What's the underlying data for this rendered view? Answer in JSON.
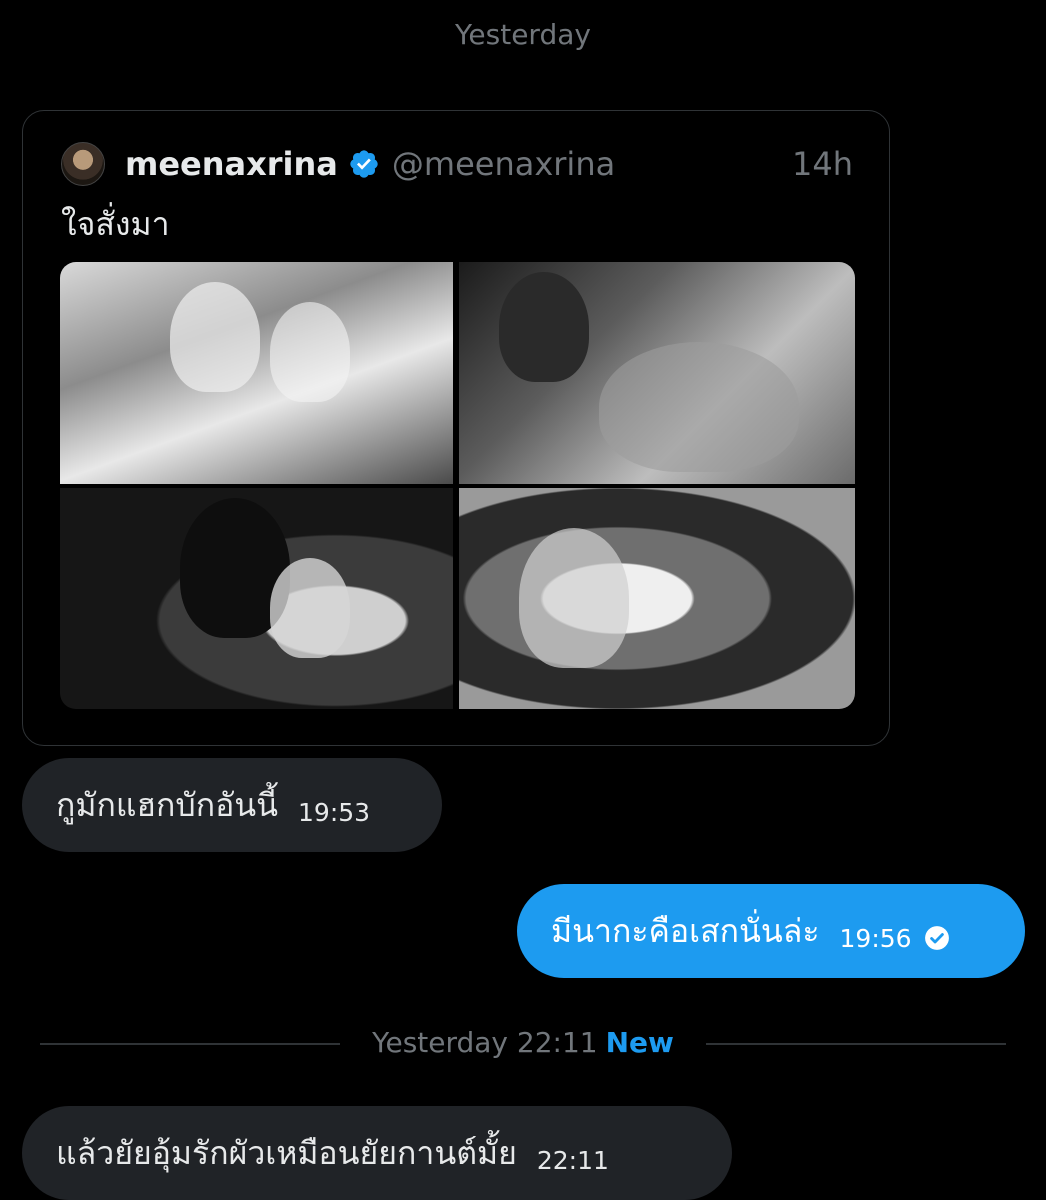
{
  "day_label": "Yesterday",
  "tweet": {
    "display_name": "meenaxrina",
    "handle": "@meenaxrina",
    "time": "14h",
    "text": "ใจสั่งมา",
    "verified": true,
    "photos": [
      "photo-1",
      "photo-2",
      "photo-3",
      "photo-4"
    ]
  },
  "messages": [
    {
      "text": "กูมักแฮกบักอันนี้",
      "time": "19:53",
      "direction": "incoming"
    },
    {
      "text": "มีนากะคือเสกนั่นล่ะ",
      "time": "19:56",
      "direction": "outgoing",
      "read": true
    }
  ],
  "divider": {
    "date": "Yesterday 22:11",
    "badge": "New"
  },
  "messages_after": [
    {
      "text": "แล้วยัยอุ้มรักผัวเหมือนยัยกานต์มั้ย",
      "time": "22:11",
      "direction": "incoming"
    }
  ],
  "colors": {
    "background": "#000000",
    "incoming_bubble": "#202327",
    "outgoing_bubble": "#1d9bf0",
    "muted_text": "#71767b",
    "accent": "#1d9bf0"
  }
}
